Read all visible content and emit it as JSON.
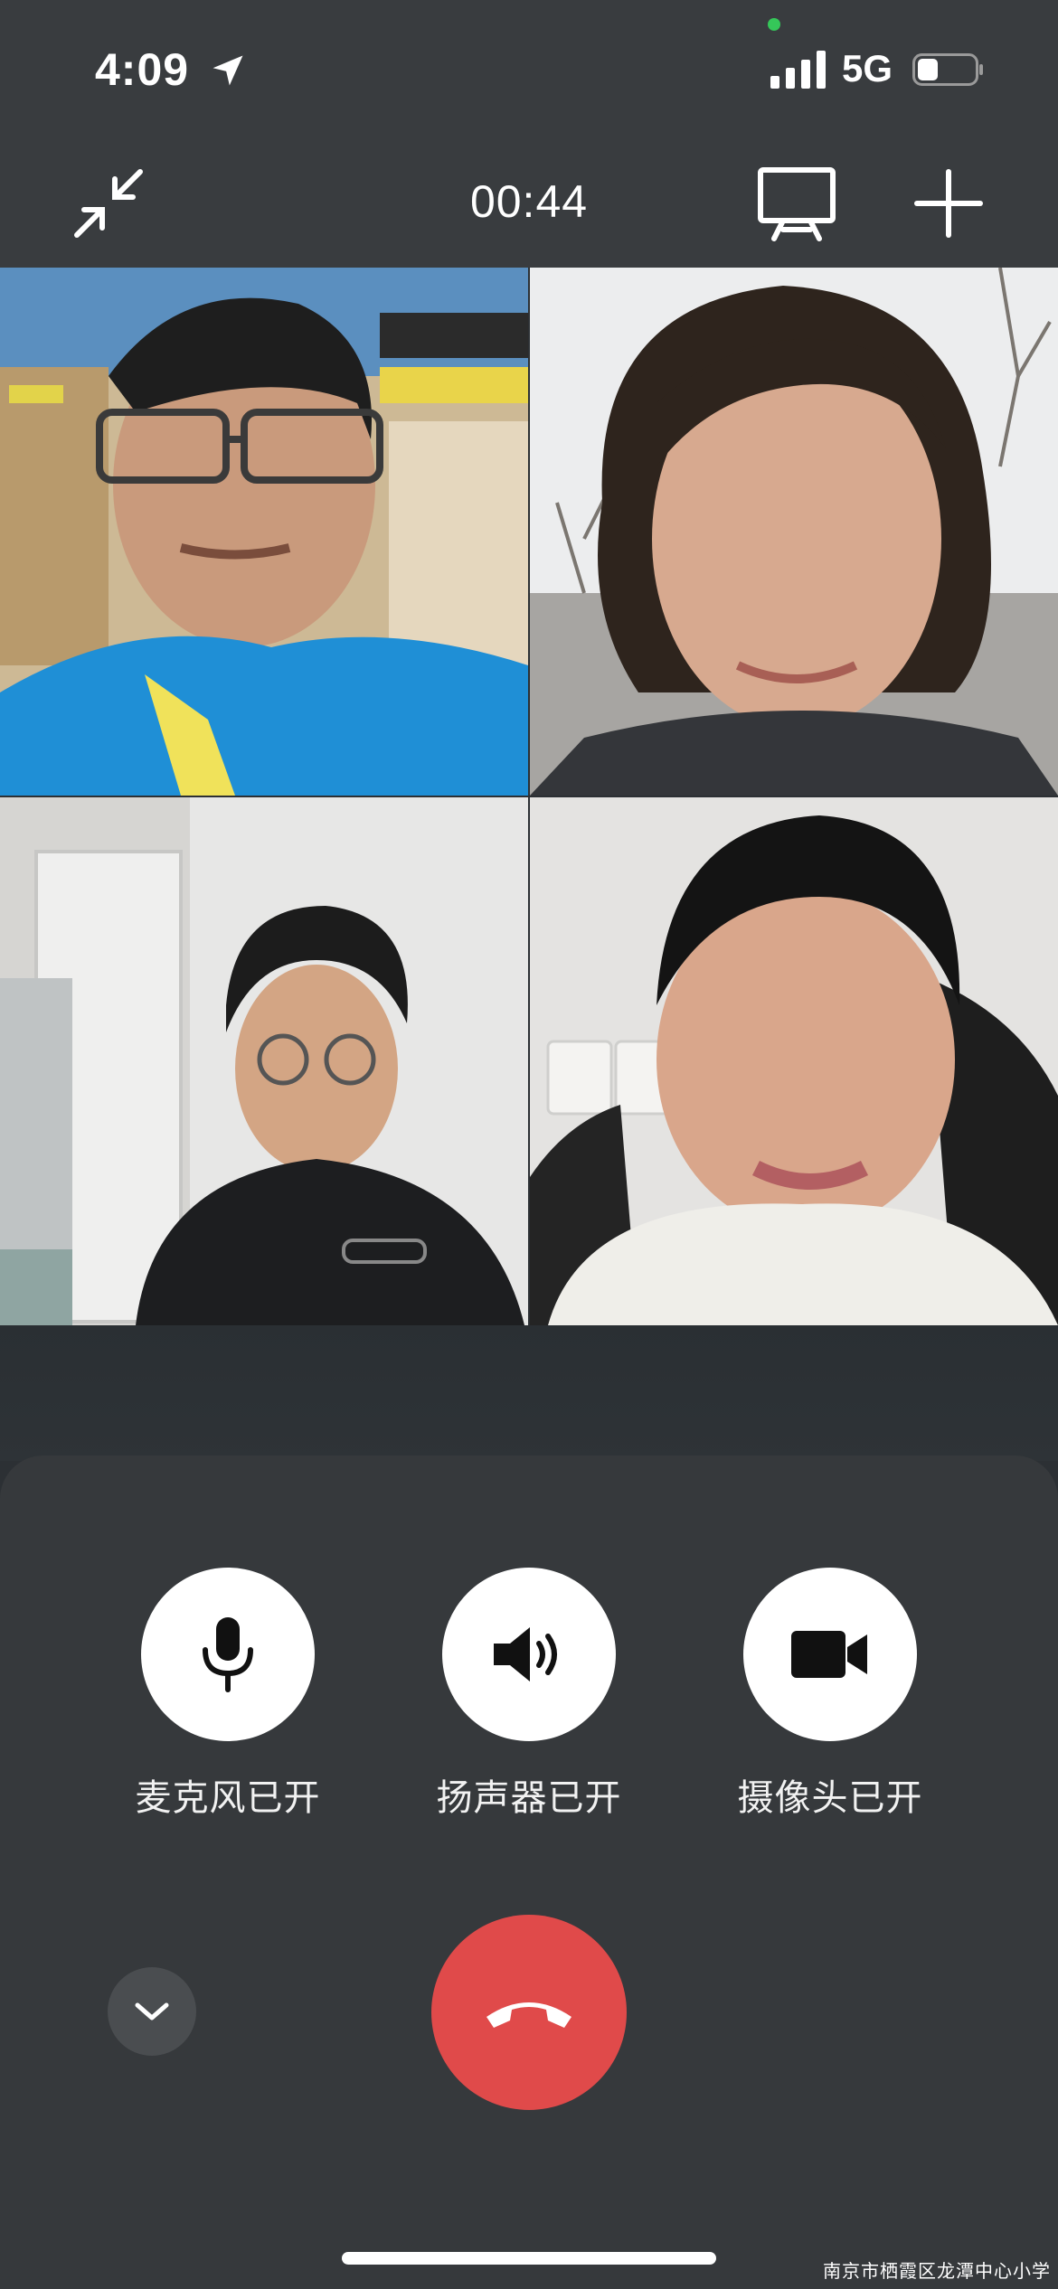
{
  "status_bar": {
    "time": "4:09",
    "network": "5G",
    "icons": [
      "location-arrow-icon",
      "signal-bars-icon",
      "battery-icon"
    ],
    "camera_indicator_color": "#35c759"
  },
  "toolbar": {
    "timer": "00:44",
    "icons": [
      "collapse-arrows-icon",
      "screen-share-icon",
      "plus-icon"
    ]
  },
  "participants": [
    {
      "position": "top-left",
      "description_icon": "video-feed"
    },
    {
      "position": "top-right",
      "description_icon": "video-feed"
    },
    {
      "position": "bottom-left",
      "description_icon": "video-feed"
    },
    {
      "position": "bottom-right",
      "description_icon": "video-feed"
    }
  ],
  "controls": {
    "microphone": {
      "label": "麦克风已开",
      "icon": "microphone-icon"
    },
    "speaker": {
      "label": "扬声器已开",
      "icon": "speaker-icon"
    },
    "camera": {
      "label": "摄像头已开",
      "icon": "video-camera-icon"
    }
  },
  "bottom": {
    "collapse_icon": "chevron-down-icon",
    "hangup_icon": "hang-up-phone-icon",
    "hangup_color": "#e04a4a"
  },
  "watermark": "南京市栖霞区龙潭中心小学"
}
